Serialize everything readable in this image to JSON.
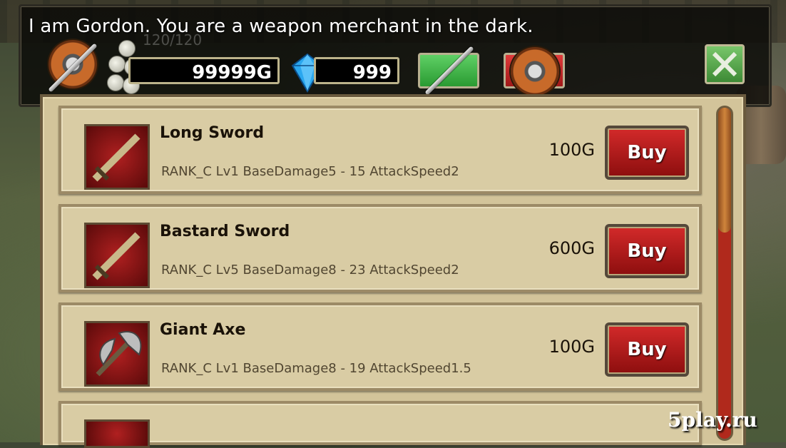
{
  "dialog": {
    "text": "I am Gordon. You are a weapon merchant in the dark."
  },
  "player": {
    "hp_text": "120/120"
  },
  "currency": {
    "gold": "99999G",
    "gems": "999"
  },
  "icons": {
    "profile": "shield-sword-icon",
    "coins": "coins-icon",
    "gem": "blue-gem-icon",
    "weapon_tab": "sword-icon",
    "armor_tab": "shield-icon",
    "close": "close-x-icon"
  },
  "colors": {
    "buy_button": "#c41f1f",
    "weapon_tab": "#3fb548",
    "panel": "#d3c49a"
  },
  "shop": {
    "items": [
      {
        "name": "Long Sword",
        "desc": "RANK_C Lv1 BaseDamage5 - 15 AttackSpeed2",
        "price": "100G",
        "buy": "Buy",
        "icon": "long-sword-icon"
      },
      {
        "name": "Bastard Sword",
        "desc": "RANK_C Lv5 BaseDamage8 - 23 AttackSpeed2",
        "price": "600G",
        "buy": "Buy",
        "icon": "bastard-sword-icon"
      },
      {
        "name": "Giant Axe",
        "desc": "RANK_C Lv1 BaseDamage8 - 19 AttackSpeed1.5",
        "price": "100G",
        "buy": "Buy",
        "icon": "giant-axe-icon"
      }
    ]
  },
  "watermark": "5play.ru"
}
